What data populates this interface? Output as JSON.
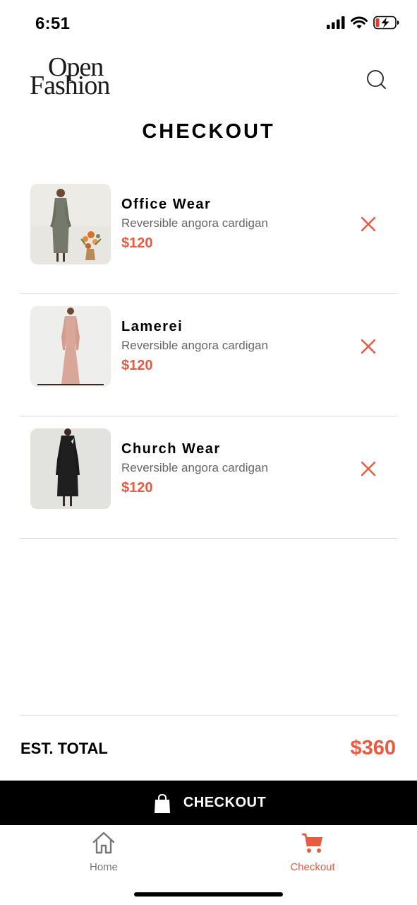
{
  "status_bar": {
    "time": "6:51",
    "icons": [
      "signal-icon",
      "wifi-icon",
      "battery-charging-icon"
    ]
  },
  "header": {
    "logo_line1": "Open",
    "logo_line2": "Fashion",
    "search_icon": "search-icon"
  },
  "page_title": "CHECKOUT",
  "cart": {
    "items": [
      {
        "name": "Office Wear",
        "description": "Reversible angora cardigan",
        "price": "$120",
        "remove_icon": "close-icon"
      },
      {
        "name": "Lamerei",
        "description": "Reversible angora cardigan",
        "price": "$120",
        "remove_icon": "close-icon"
      },
      {
        "name": "Church Wear",
        "description": "Reversible angora cardigan",
        "price": "$120",
        "remove_icon": "close-icon"
      }
    ]
  },
  "total": {
    "label": "EST. TOTAL",
    "value": "$360"
  },
  "checkout_button": {
    "label": "CHECKOUT",
    "icon": "shopping-bag-icon"
  },
  "tab_bar": {
    "tabs": [
      {
        "label": "Home",
        "icon": "home-icon",
        "active": false
      },
      {
        "label": "Checkout",
        "icon": "cart-icon",
        "active": true
      }
    ]
  },
  "colors": {
    "accent": "#ea5a3f",
    "text": "#000000",
    "muted": "#666666",
    "divider": "#d9d9d9",
    "checkout_bar": "#000000"
  }
}
